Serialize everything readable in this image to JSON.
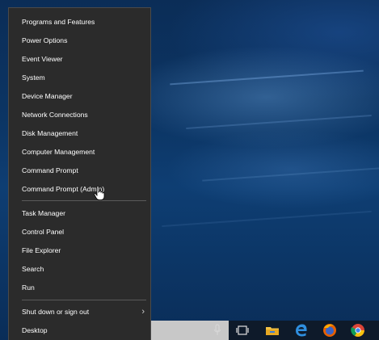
{
  "menu": {
    "items_group1": [
      "Programs and Features",
      "Power Options",
      "Event Viewer",
      "System",
      "Device Manager",
      "Network Connections",
      "Disk Management",
      "Computer Management",
      "Command Prompt",
      "Command Prompt (Admin)"
    ],
    "items_group2": [
      "Task Manager",
      "Control Panel",
      "File Explorer",
      "Search",
      "Run"
    ],
    "items_group3": [
      "Shut down or sign out",
      "Desktop"
    ]
  },
  "taskbar": {
    "icons": [
      "microphone-icon",
      "task-view-icon",
      "file-explorer-icon",
      "edge-icon",
      "firefox-icon",
      "chrome-icon"
    ]
  },
  "colors": {
    "menu_bg": "#2b2b2b",
    "menu_text": "#ffffff",
    "desktop_blue": "#0c3564"
  }
}
